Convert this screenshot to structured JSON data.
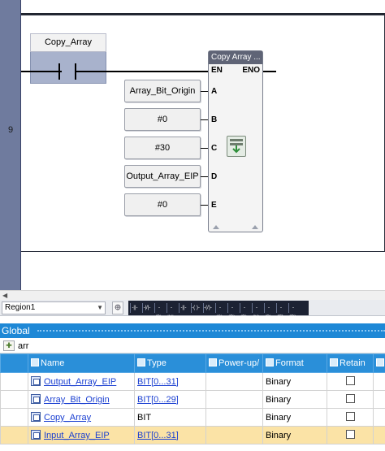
{
  "ladder": {
    "rung_number": "9",
    "contact_label": "Copy_Array",
    "function_block": {
      "title": "Copy Array ...",
      "pins": {
        "en": "EN",
        "eno": "ENO",
        "a": "A",
        "b": "B",
        "c": "C",
        "d": "D",
        "e": "E"
      }
    },
    "operands": [
      "Array_Bit_Origin",
      "#0",
      "#30",
      "Output_Array_EIP",
      "#0"
    ]
  },
  "toolbar": {
    "region": "Region1",
    "strip_buttons": [
      "-||-",
      "-|/|-",
      "-|P|-",
      "-|N|-",
      "-||-",
      "-( )-",
      "-(/)-",
      "-(S)-",
      "-(R)-",
      "-(P)-",
      "-(N)-",
      "-|P|-",
      "-[F]-",
      "-{R}-"
    ]
  },
  "global_panel": {
    "title": "Global",
    "search_value": "arr",
    "columns": [
      "Name",
      "Type",
      "Power-up/",
      "Format",
      "Retain"
    ],
    "rows": [
      {
        "name": "Output_Array_EIP",
        "type": "BIT[0...31]",
        "type_link": true,
        "format": "Binary",
        "selected": false
      },
      {
        "name": "Array_Bit_Origin",
        "type": "BIT[0...29]",
        "type_link": true,
        "format": "Binary",
        "selected": false
      },
      {
        "name": "Copy_Array",
        "type": "BIT",
        "type_link": false,
        "format": "Binary",
        "selected": false
      },
      {
        "name": "Input_Array_EIP",
        "type": "BIT[0...31]",
        "type_link": true,
        "format": "Binary",
        "selected": true
      }
    ]
  }
}
